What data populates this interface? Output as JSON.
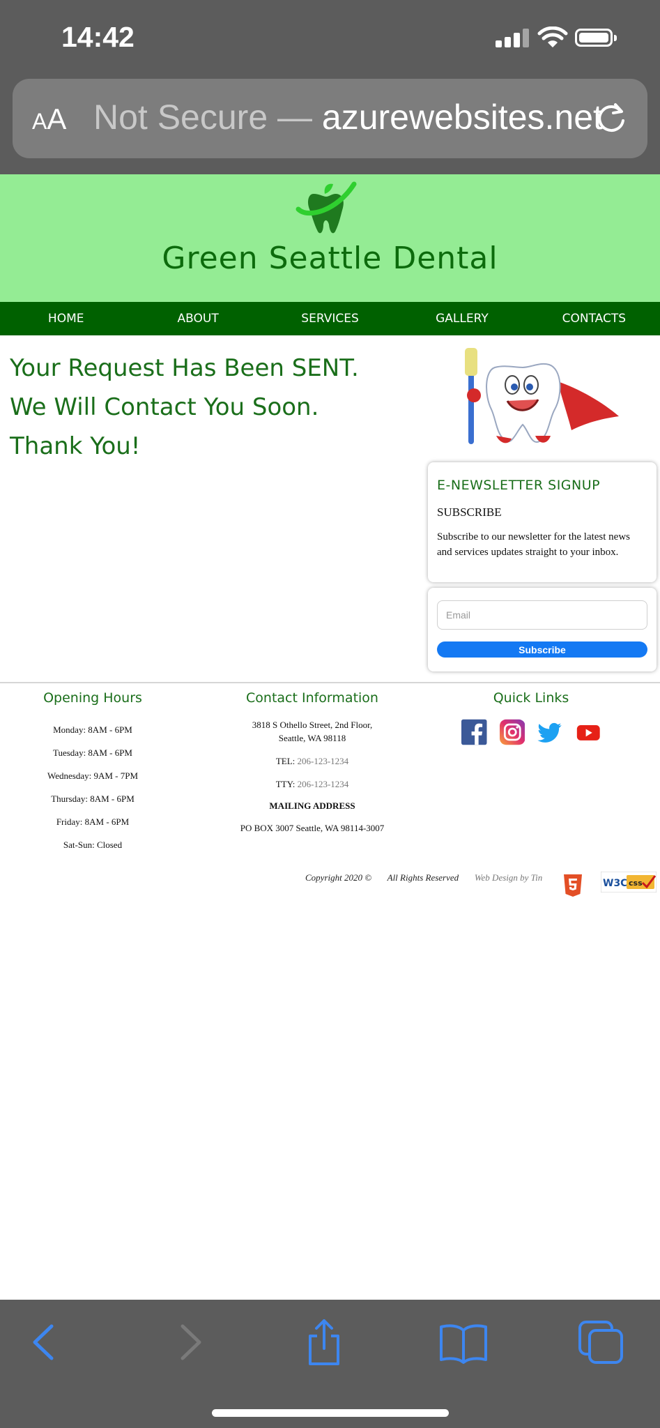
{
  "status_bar": {
    "time": "14:42"
  },
  "browser": {
    "aa_label_small": "A",
    "aa_label_large": "A",
    "url_faded": "Not Secure — ",
    "url_host": "azurewebsites.net"
  },
  "header": {
    "title": "Green Seattle Dental"
  },
  "nav": {
    "items": [
      "HOME",
      "ABOUT",
      "SERVICES",
      "GALLERY",
      "CONTACTS"
    ]
  },
  "main": {
    "message_lines": [
      "Your Request Has Been SENT.",
      "We Will Contact You Soon.",
      "Thank You!"
    ]
  },
  "newsletter": {
    "title": "E-NEWSLETTER SIGNUP",
    "subscribe_heading": "SUBSCRIBE",
    "description": "Subscribe to our newsletter for the latest news and services updates straight to your inbox.",
    "email_placeholder": "Email",
    "button_label": "Subscribe"
  },
  "footer": {
    "hours": {
      "heading": "Opening Hours",
      "lines": [
        "Monday: 8AM - 6PM",
        "Tuesday: 8AM - 6PM",
        "Wednesday: 9AM - 7PM",
        "Thursday: 8AM - 6PM",
        "Friday: 8AM - 6PM",
        "Sat-Sun: Closed"
      ]
    },
    "contact": {
      "heading": "Contact Information",
      "address_line1": "3818 S Othello Street, 2nd Floor,",
      "address_line2": "Seattle, WA 98118",
      "tel_label": "TEL: ",
      "tel_number": "206-123-1234",
      "tty_label": "TTY: ",
      "tty_number": "206-123-1234",
      "mailing_heading": "MAILING ADDRESS",
      "mailing_address": "PO BOX 3007 Seattle, WA 98114-3007"
    },
    "quick_links": {
      "heading": "Quick Links",
      "icons": [
        "facebook-icon",
        "instagram-icon",
        "twitter-icon",
        "youtube-icon"
      ]
    },
    "copyright": "Copyright 2020 ©",
    "rights": "All Rights Reserved",
    "credit": "Web Design by Tin",
    "badges": [
      "html5-badge",
      "w3c-css-badge"
    ]
  },
  "colors": {
    "header_bg": "#94ec94",
    "nav_bg": "#006100",
    "brand_green": "#1a6e1a",
    "button_blue": "#1479f3",
    "browser_chrome": "#5c5c5c",
    "ios_link_blue": "#3d86f0"
  }
}
